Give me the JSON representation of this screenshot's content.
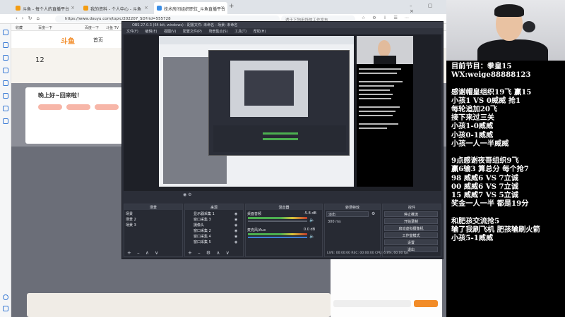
{
  "browser": {
    "tabs": [
      {
        "label": "斗鱼 - 每个人的直播平台",
        "active": false
      },
      {
        "label": "我的资料 - 个人中心 - 斗鱼",
        "active": false
      },
      {
        "label": "技术房间组织职位_斗鱼直播平台",
        "active": true
      }
    ],
    "url": "https://www.douyu.com/topic/202207_SD?rid=555728",
    "search_hint": "透于下狗用饰旅工作发布",
    "bookmarks": [
      "收藏",
      "百度一下",
      "百度一下",
      "斗鱼 TV"
    ]
  },
  "page": {
    "logo_text": "斗鱼",
    "nav_first": "首页",
    "count": "12",
    "banner_text": "晚上好~回来啦！"
  },
  "obs": {
    "title": "OBS 27.0.3 (64-bit, windows) - 配置文件: 未命名 - 场景: 未命名",
    "menu": [
      "文件(F)",
      "编辑(E)",
      "视图(V)",
      "配置文件(P)",
      "场景集合(S)",
      "工具(T)",
      "帮助(H)"
    ],
    "scene_panel_title": "场景",
    "scenes": [
      "场景",
      "场景 2",
      "场景 3"
    ],
    "sources_panel_title": "来源",
    "sources": [
      "显示器采集 1",
      "窗口采集 3",
      "摄像头",
      "窗口采集 2",
      "窗口采集 4",
      "窗口采集 5"
    ],
    "mixer_panel_title": "混音器",
    "mixer_channels": [
      {
        "name": "桌面音频",
        "level": "-5.8 dB"
      },
      {
        "name": "麦克风/Aux",
        "level": "0.0 dB"
      }
    ],
    "transition_panel_title": "转场特效",
    "transition_value": "淡出",
    "transition_duration": "300 ms",
    "controls_panel_title": "控件",
    "controls": [
      "停止推流",
      "开始录制",
      "启动虚拟摄像机",
      "工作室模式",
      "设置",
      "退出"
    ],
    "status": "LIVE: 00:00:00   REC: 00:00:00   CPU: 6.8%, 60.00 fps"
  },
  "overlay": {
    "lines": [
      "目前节目：拳皇15",
      "WX:weige88888123",
      "",
      "感谢帽皇组织19飞 赢15",
      "小孩1 VS 0威威 抢1",
      "每轮追加20飞",
      "接下来过三关",
      "小孩1-0威威",
      "小孩0-1威威",
      "小孩一人一半威威",
      "",
      "9点感谢夜哥组织9飞",
      "赢6输3 算总分 每个抢7",
      "98 威威6 VS 7立诚",
      "00 威威6 VS 7立诚",
      "15 威威7 VS 5立诚",
      "奖金一人一半 都是19分",
      "",
      "和肥孩交流抢5",
      "输了我刷飞机 肥孩输刷火箭",
      "小孩5-1威威"
    ]
  }
}
